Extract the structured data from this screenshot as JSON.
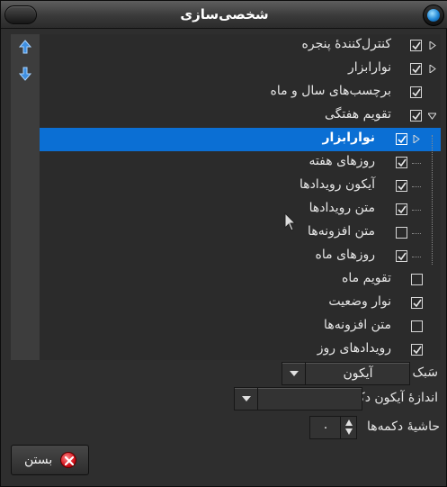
{
  "window": {
    "title": "شخصی‌سازی"
  },
  "list": {
    "rows": [
      {
        "label": "کنترل‌کنندهٔ پنجره",
        "checked": true,
        "expander": "collapsed"
      },
      {
        "label": "نوارابزار",
        "checked": true,
        "expander": "collapsed"
      },
      {
        "label": "برچسب‌های سال و ماه",
        "checked": true,
        "expander": "none"
      },
      {
        "label": "تقویم هفتگی",
        "checked": true,
        "expander": "expanded"
      },
      {
        "label": "نوارابزار",
        "checked": true,
        "expander": "collapsed",
        "selected": true
      },
      {
        "label": "روزهای هفته",
        "checked": true,
        "expander": "none"
      },
      {
        "label": "آیکون رویدادها",
        "checked": true,
        "expander": "none"
      },
      {
        "label": "متن رویدادها",
        "checked": true,
        "expander": "none"
      },
      {
        "label": "متن افزونه‌ها",
        "checked": false,
        "expander": "none"
      },
      {
        "label": "روزهای ماه",
        "checked": true,
        "expander": "none"
      },
      {
        "label": "تقویم ماه",
        "checked": false,
        "expander": "none"
      },
      {
        "label": "نوار وضعیت",
        "checked": true,
        "expander": "none"
      },
      {
        "label": "متن افزونه‌ها",
        "checked": false,
        "expander": "none"
      },
      {
        "label": "رویدادهای روز",
        "checked": true,
        "expander": "none"
      }
    ]
  },
  "strip": {
    "up_icon": "arrow-up-icon",
    "down_icon": "arrow-down-icon"
  },
  "form": {
    "style_label": "سَبک",
    "style_value": "آیکون",
    "icon_size_label": "اندازهٔ آیکون دکمه",
    "icon_size_value": "",
    "padding_label": "حاشیهٔ دکمه‌ها",
    "padding_value": "۰"
  },
  "footer": {
    "close_label": "بستن"
  },
  "colors": {
    "selection": "#0b6fd4",
    "background": "#2e2e2e",
    "title_orb": "#1f86d6",
    "close_icon": "#d3101a"
  }
}
